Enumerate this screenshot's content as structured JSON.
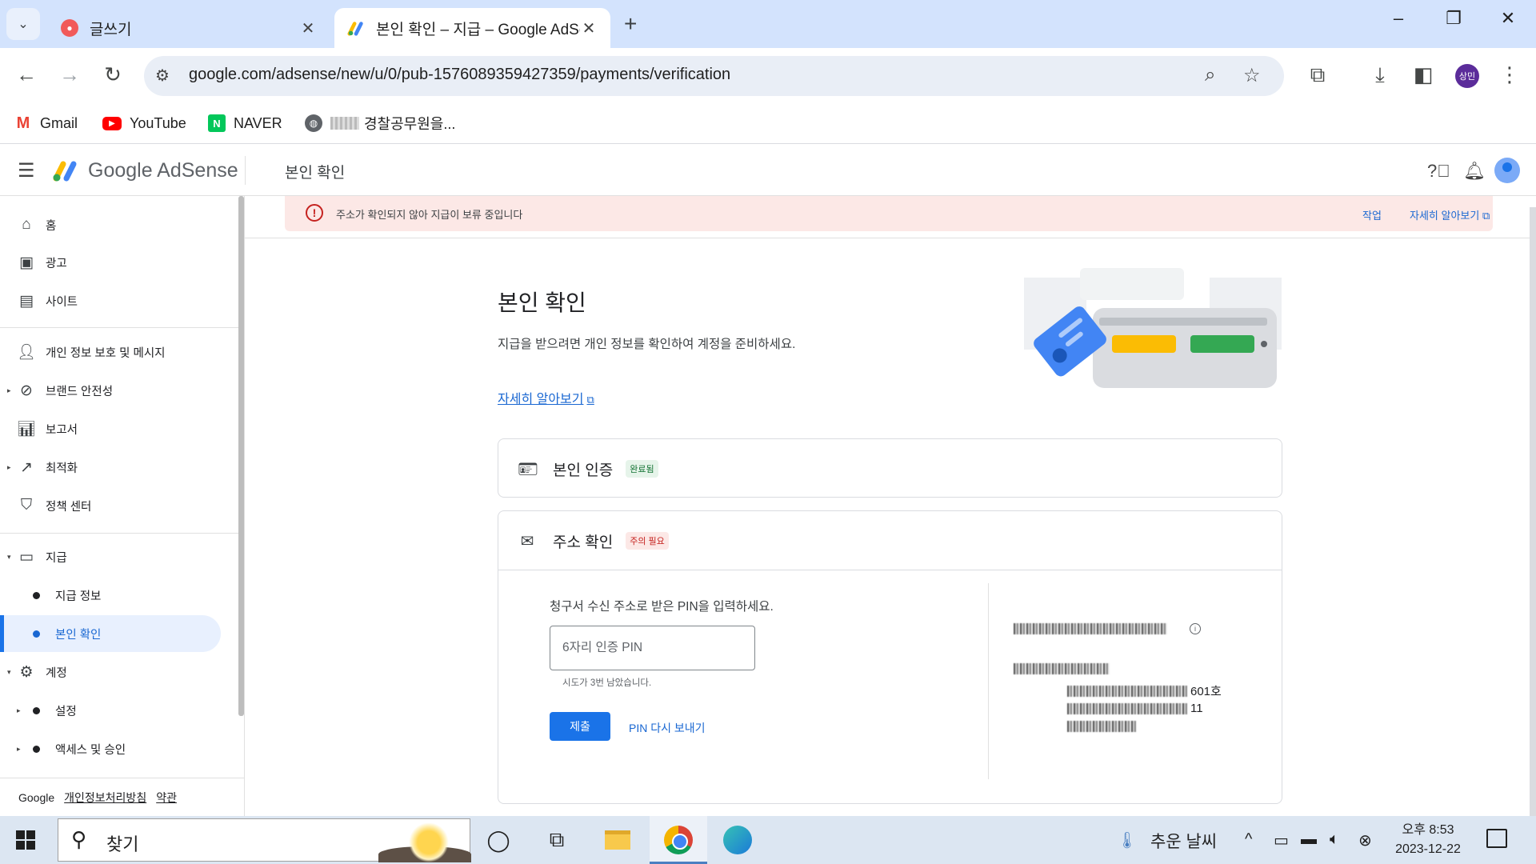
{
  "browser": {
    "tabs": [
      {
        "title": "글쓰기",
        "active": false
      },
      {
        "title": "본인 확인 – 지급 – Google AdSense",
        "active": true
      }
    ],
    "url": "google.com/adsense/new/u/0/pub-1576089359427359/payments/verification",
    "profile_label": "상민",
    "bookmarks": [
      {
        "label": "Gmail",
        "icon": "gmail-icon"
      },
      {
        "label": "YouTube",
        "icon": "youtube-icon"
      },
      {
        "label": "NAVER",
        "icon": "naver-icon"
      },
      {
        "label": "경찰공무원을...",
        "icon": "globe-icon"
      }
    ]
  },
  "adsense": {
    "brand": "Google AdSense",
    "page_title": "본인 확인",
    "colors": {
      "accent": "#1a73e8",
      "alert_bg": "#fce8e6",
      "error": "#c5221f",
      "success": "#137333"
    }
  },
  "sidebar": {
    "items": [
      {
        "label": "홈",
        "icon": "home-icon"
      },
      {
        "label": "광고",
        "icon": "ads-icon"
      },
      {
        "label": "사이트",
        "icon": "sites-icon"
      },
      {
        "label": "개인 정보 보호 및 메시지",
        "icon": "privacy-icon"
      },
      {
        "label": "브랜드 안전성",
        "icon": "block-icon"
      },
      {
        "label": "보고서",
        "icon": "reports-icon"
      },
      {
        "label": "최적화",
        "icon": "trending-icon"
      },
      {
        "label": "정책 센터",
        "icon": "policy-shield-icon"
      },
      {
        "label": "지급",
        "icon": "payments-icon"
      },
      {
        "label": "지급 정보",
        "icon": "dot-icon"
      },
      {
        "label": "본인 확인",
        "icon": "dot-icon",
        "selected": true
      },
      {
        "label": "계정",
        "icon": "settings-gear-icon"
      },
      {
        "label": "설정",
        "icon": "dot-icon"
      },
      {
        "label": "액세스 및 승인",
        "icon": "dot-icon"
      }
    ],
    "footer": {
      "google": "Google",
      "privacy": "개인정보처리방침",
      "terms": "약관"
    }
  },
  "alert": {
    "message": "주소가 확인되지 않아 지급이 보류 중입니다",
    "action": "작업",
    "learn_more": "자세히 알아보기"
  },
  "main": {
    "heading": "본인 확인",
    "description": "지급을 받으려면 개인 정보를 확인하여 계정을 준비하세요.",
    "learn_more": "자세히 알아보기",
    "identity_card": {
      "title": "본인 인증",
      "status": "완료됨"
    },
    "address_card": {
      "title": "주소 확인",
      "status": "주의 필요",
      "instruction": "청구서 수신 주소로 받은 PIN을 입력하세요.",
      "pin_placeholder": "6자리 인증 PIN",
      "pin_value": "",
      "attempts_left": "시도가 3번 남았습니다.",
      "submit_label": "제출",
      "resend_label": "PIN 다시 보내기",
      "address_fragments": {
        "unit": "601호",
        "number": "11"
      }
    }
  },
  "taskbar": {
    "search_placeholder": "찾기",
    "weather": "추운 날씨",
    "time": "오후 8:53",
    "date": "2023-12-22"
  }
}
